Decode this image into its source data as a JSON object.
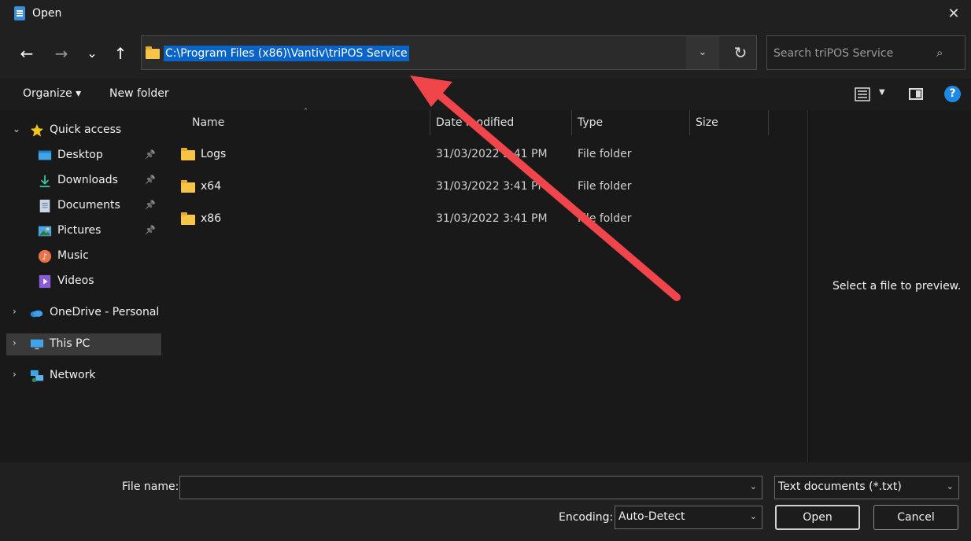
{
  "window": {
    "title": "Open",
    "close_glyph": "✕"
  },
  "nav": {
    "back_glyph": "←",
    "forward_glyph": "→",
    "recent_glyph": "⌄",
    "up_glyph": "↑",
    "address_path": "C:\\Program Files (x86)\\Vantiv\\triPOS Service",
    "address_dropdown_glyph": "⌄",
    "refresh_glyph": "↻",
    "search_placeholder": "Search triPOS Service",
    "search_glyph": "⌕"
  },
  "toolbar": {
    "organize_label": "Organize ▾",
    "new_folder_label": "New folder",
    "help_glyph": "?"
  },
  "navpane": {
    "quick_access": "Quick access",
    "items": [
      {
        "label": "Desktop",
        "icon": "desktop-icon",
        "pinned": true
      },
      {
        "label": "Downloads",
        "icon": "downloads-icon",
        "pinned": true
      },
      {
        "label": "Documents",
        "icon": "documents-icon",
        "pinned": true
      },
      {
        "label": "Pictures",
        "icon": "pictures-icon",
        "pinned": true
      },
      {
        "label": "Music",
        "icon": "music-icon",
        "pinned": false
      },
      {
        "label": "Videos",
        "icon": "videos-icon",
        "pinned": false
      }
    ],
    "onedrive": "OneDrive - Personal",
    "this_pc": "This PC",
    "network": "Network",
    "expand_glyph": "›",
    "collapse_glyph": "⌄",
    "pin_glyph": "📌"
  },
  "filelist": {
    "columns": {
      "name": "Name",
      "date": "Date modified",
      "type": "Type",
      "size": "Size"
    },
    "sort_glyph": "˄",
    "rows": [
      {
        "name": "Logs",
        "date": "31/03/2022 3:41 PM",
        "type": "File folder"
      },
      {
        "name": "x64",
        "date": "31/03/2022 3:41 PM",
        "type": "File folder"
      },
      {
        "name": "x86",
        "date": "31/03/2022 3:41 PM",
        "type": "File folder"
      }
    ]
  },
  "preview": {
    "message": "Select a file to preview."
  },
  "bottom": {
    "file_name_label": "File name:",
    "file_name_value": "",
    "file_type_value": "Text documents (*.txt)",
    "encoding_label": "Encoding:",
    "encoding_value": "Auto-Detect",
    "open_label": "Open",
    "cancel_label": "Cancel",
    "caret_glyph": "⌄"
  },
  "colors": {
    "accent": "#0a64c8",
    "folder": "#f6c548",
    "annotation_arrow": "#f0454b"
  }
}
